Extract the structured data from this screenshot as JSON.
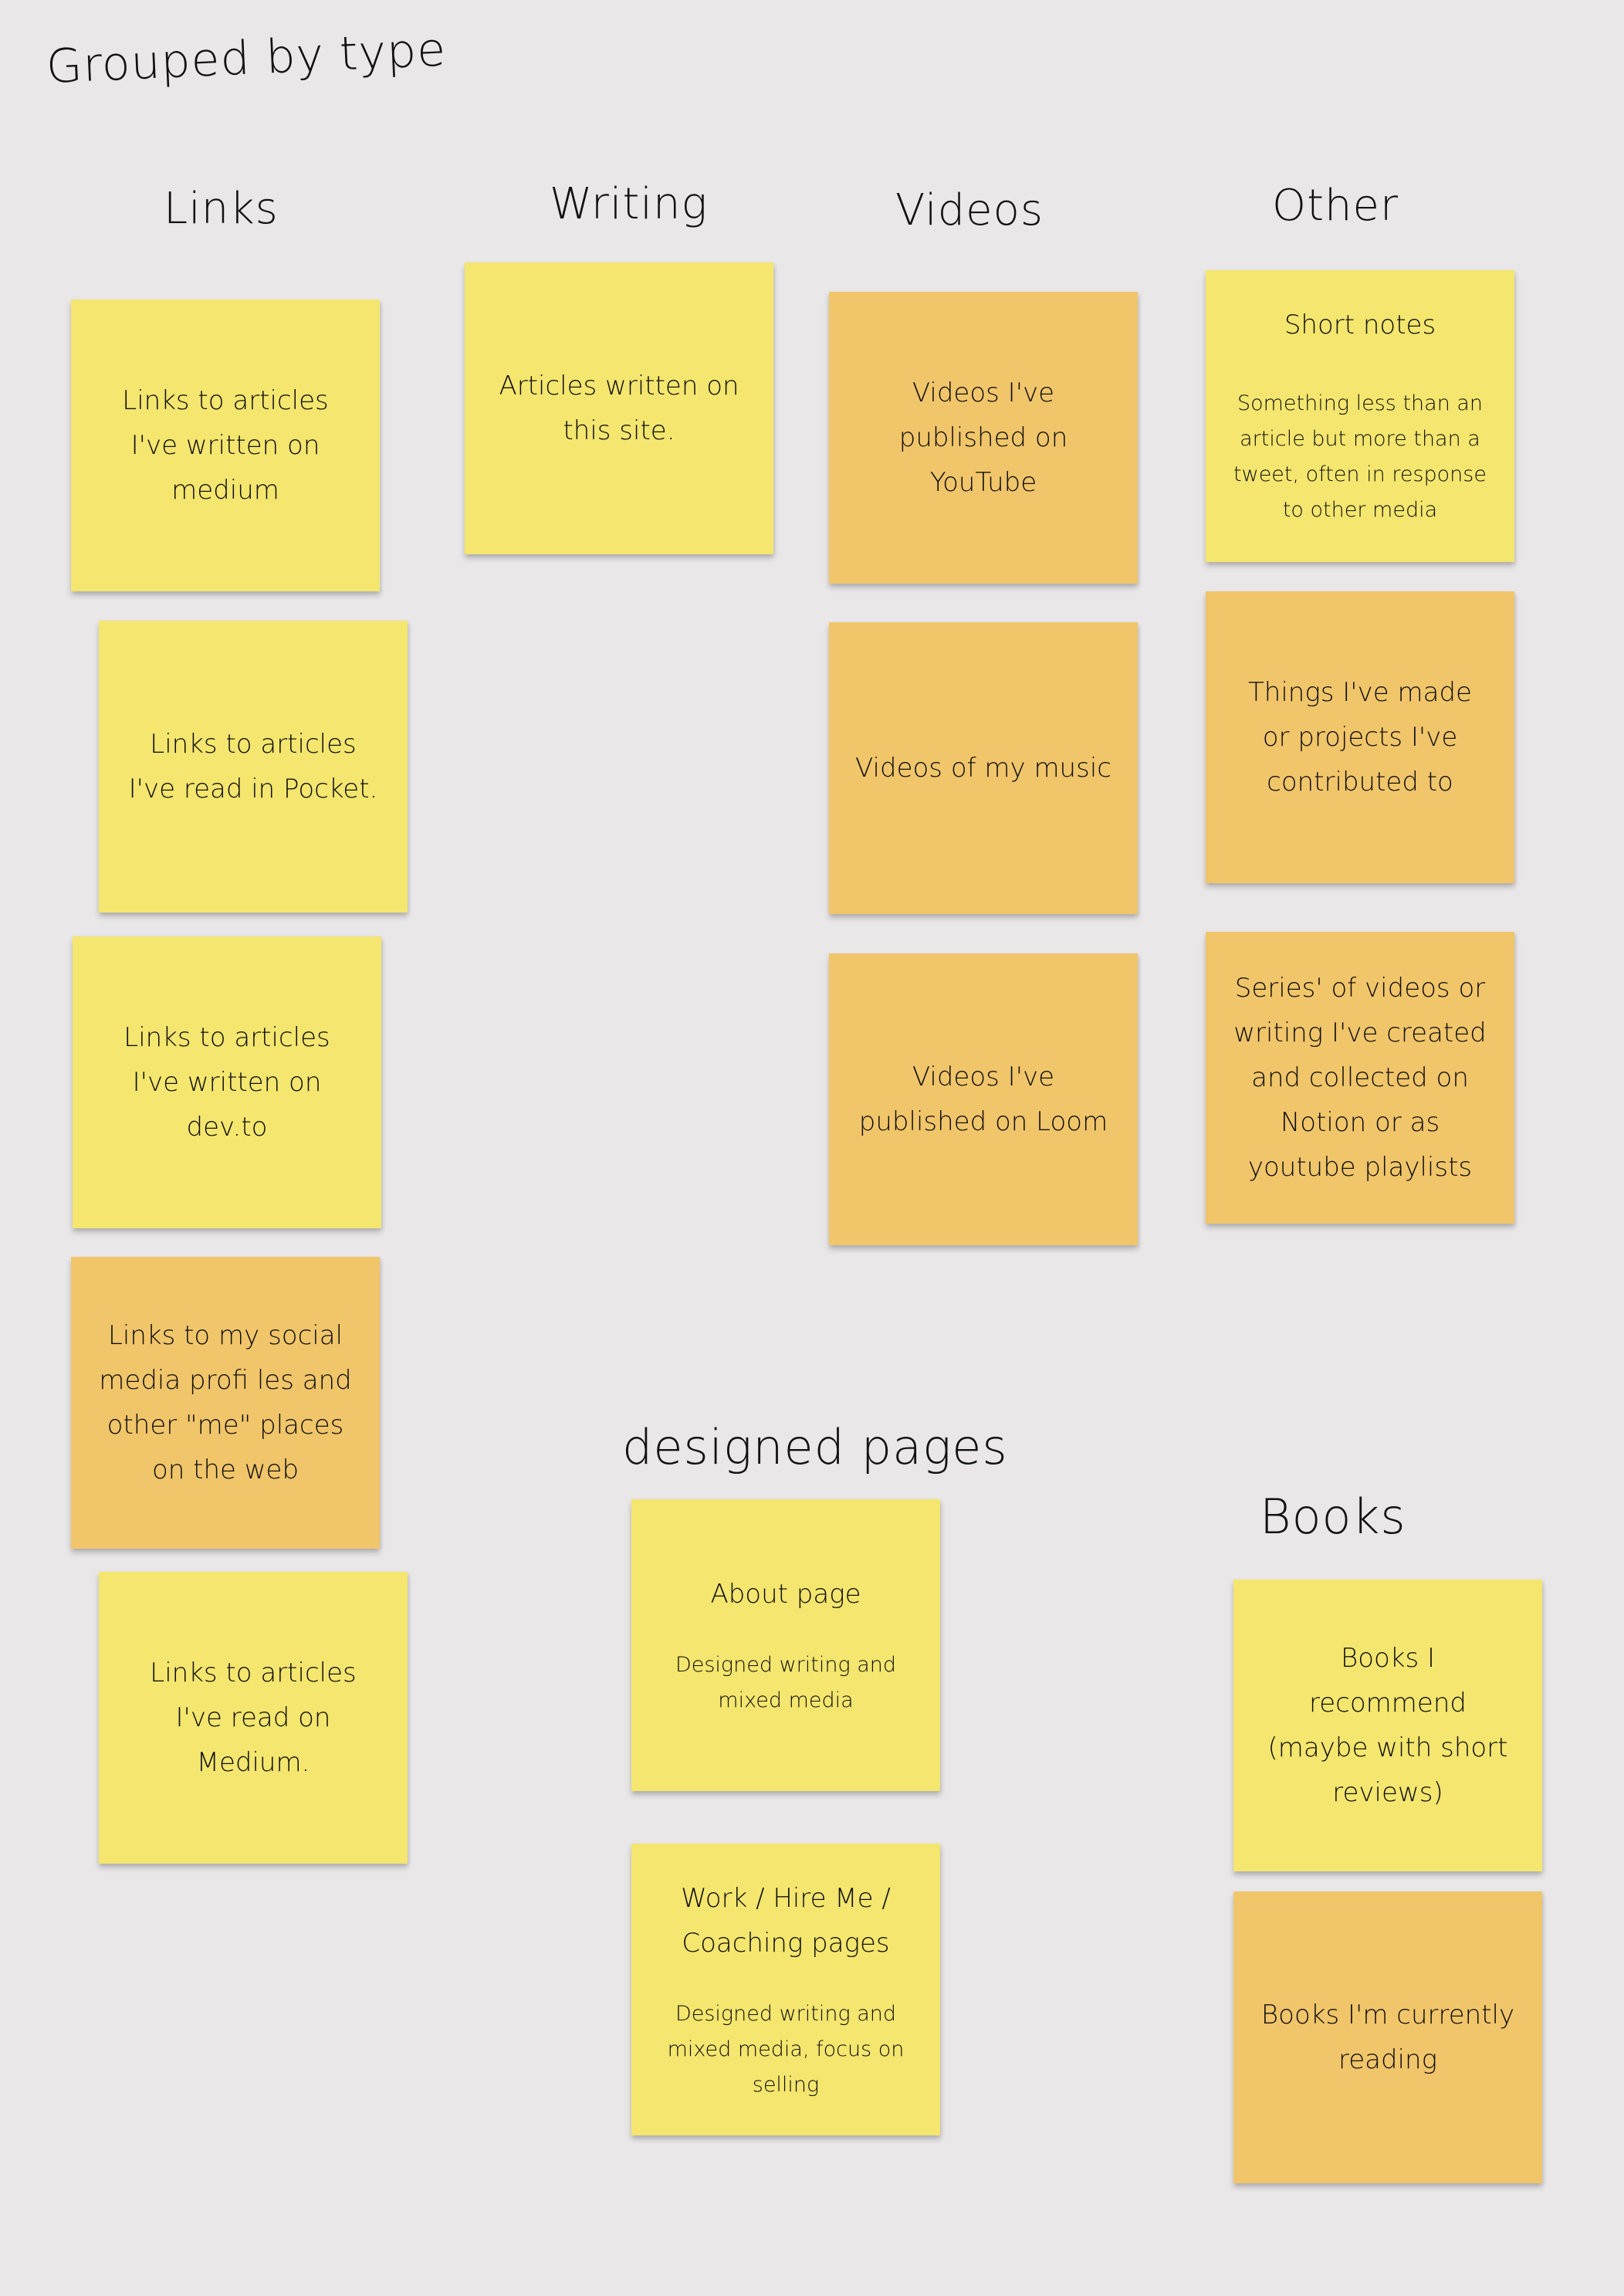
{
  "board": {
    "title": "Grouped by type",
    "colors": {
      "background": "#E9E7E8",
      "yellow_sticky": "#F4E66E",
      "orange_sticky": "#F1C56A",
      "text": "#111111"
    }
  },
  "groups": {
    "links": {
      "heading": "Links",
      "stickies": [
        {
          "color": "yellow",
          "text": "Links to articles I've written on medium"
        },
        {
          "color": "yellow",
          "text": "Links to articles I've read in Pocket."
        },
        {
          "color": "yellow",
          "text": "Links to articles I've written on dev.to"
        },
        {
          "color": "orange",
          "text": "Links to my social media profi les and other \"me\" places on the web"
        },
        {
          "color": "yellow",
          "text": "Links to articles I've read on Medium."
        }
      ]
    },
    "writing": {
      "heading": "Writing",
      "stickies": [
        {
          "color": "yellow",
          "text": "Articles written on this site."
        }
      ]
    },
    "videos": {
      "heading": "Videos",
      "stickies": [
        {
          "color": "orange",
          "text": "Videos I've published on YouTube"
        },
        {
          "color": "orange",
          "text": "Videos of my music"
        },
        {
          "color": "orange",
          "text": "Videos I've published on Loom"
        }
      ]
    },
    "other": {
      "heading": "Other",
      "stickies": [
        {
          "color": "yellow",
          "title": "Short notes",
          "text": "Something less than an article but more than a tweet, often in response to other media"
        },
        {
          "color": "orange",
          "text": "Things I've made or projects I've contributed to"
        },
        {
          "color": "orange",
          "text": "Series' of videos or writing I've created and collected on Notion or as youtube playlists"
        }
      ]
    },
    "designed_pages": {
      "heading": "designed pages",
      "stickies": [
        {
          "color": "yellow",
          "title": "About page",
          "text": "Designed writing and mixed media"
        },
        {
          "color": "yellow",
          "title": "Work / Hire Me / Coaching pages",
          "text": "Designed writing and mixed media, focus on selling"
        }
      ]
    },
    "books": {
      "heading": "Books",
      "stickies": [
        {
          "color": "yellow",
          "text": "Books I recommend (maybe with short reviews)"
        },
        {
          "color": "orange",
          "text": "Books I'm currently reading"
        }
      ]
    }
  }
}
